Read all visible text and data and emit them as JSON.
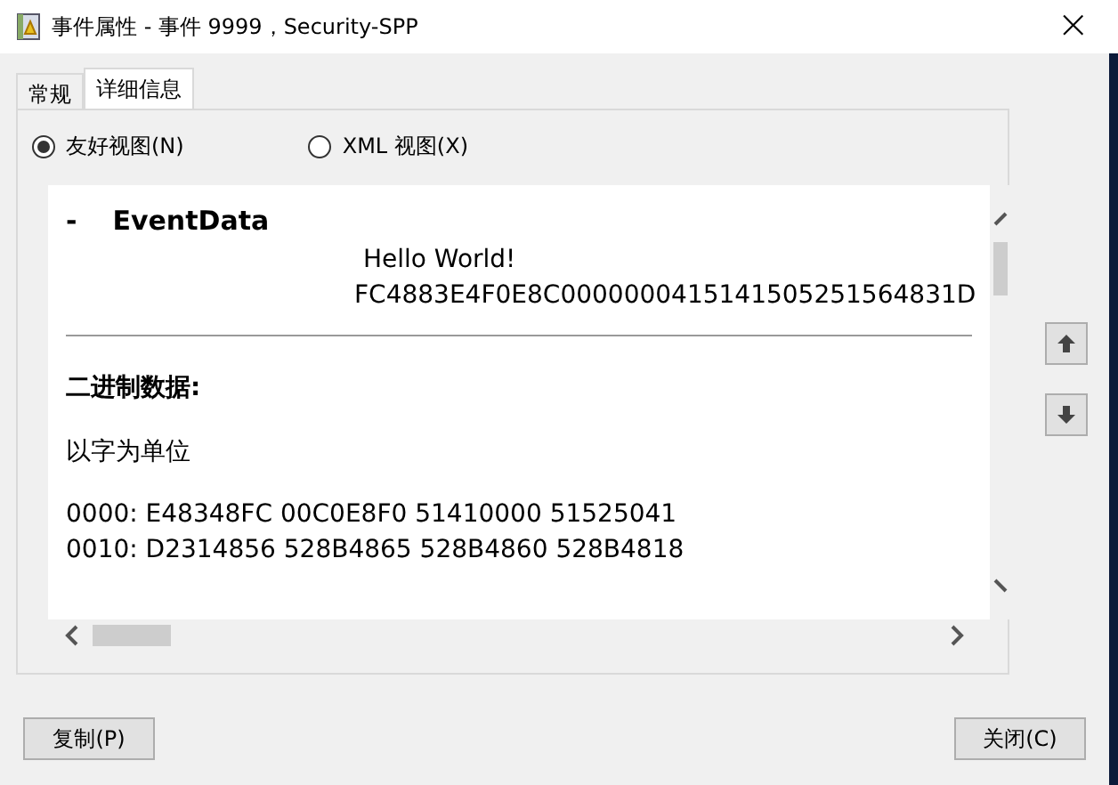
{
  "window": {
    "title": "事件属性 - 事件 9999，Security-SPP",
    "close": "×"
  },
  "tabs": [
    {
      "label": "常规",
      "selected": false
    },
    {
      "label": "详细信息",
      "selected": true
    }
  ],
  "views": [
    {
      "label": "友好视图(N)",
      "selected": true
    },
    {
      "label": "XML 视图(X)",
      "selected": false
    }
  ],
  "content": {
    "section_marker": "-",
    "section_title": "EventData",
    "values": [
      "Hello World!",
      "FC4883E4F0E8C0000000415141505251564831D"
    ],
    "binary_heading": "二进制数据:",
    "unit_label": "以字为单位",
    "hex_lines": [
      "0000: E48348FC 00C0E8F0 51410000 51525041",
      "0010: D2314856 528B4865 528B4860 528B4818"
    ]
  },
  "buttons": [
    {
      "label": "复制(P)",
      "kind": "copy"
    },
    {
      "label": "关闭(C)",
      "kind": "close"
    }
  ]
}
